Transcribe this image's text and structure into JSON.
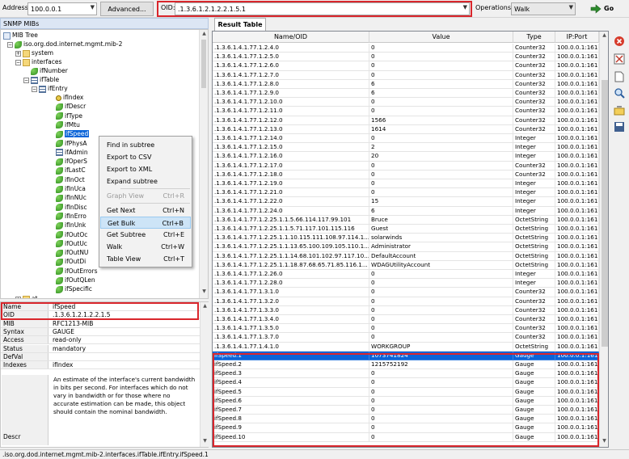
{
  "toolbar": {
    "address_label": "Address:",
    "address_value": "100.0.0.1",
    "advanced_label": "Advanced...",
    "oid_label": "OID:",
    "oid_value": ".1.3.6.1.2.1.2.2.1.5.1",
    "operations_label": "Operations:",
    "operation_value": "Walk",
    "go_label": "Go"
  },
  "left": {
    "panel_title": "SNMP MIBs",
    "tree": [
      {
        "label": "MIB Tree",
        "icon": "tree-icon"
      },
      {
        "label": "iso.org.dod.internet.mgmt.mib-2",
        "icon": "leaf-icon"
      },
      {
        "label": "system",
        "icon": "folder-icon"
      },
      {
        "label": "interfaces",
        "icon": "folder-icon"
      },
      {
        "label": "ifNumber",
        "icon": "leaf-icon"
      },
      {
        "label": "ifTable",
        "icon": "table-icon"
      },
      {
        "label": "ifEntry",
        "icon": "table-icon"
      },
      {
        "label": "ifIndex",
        "icon": "key-icon"
      },
      {
        "label": "ifDescr",
        "icon": "leaf-icon"
      },
      {
        "label": "ifType",
        "icon": "leaf-icon"
      },
      {
        "label": "ifMtu",
        "icon": "leaf-icon"
      },
      {
        "label": "ifSpeed",
        "icon": "leaf-icon"
      },
      {
        "label": "ifPhysA",
        "icon": "leaf-icon"
      },
      {
        "label": "ifAdmin",
        "icon": "edit-icon"
      },
      {
        "label": "ifOperS",
        "icon": "leaf-icon"
      },
      {
        "label": "ifLastC",
        "icon": "leaf-icon"
      },
      {
        "label": "ifInOct",
        "icon": "leaf-icon"
      },
      {
        "label": "ifInUca",
        "icon": "leaf-icon"
      },
      {
        "label": "ifInNUc",
        "icon": "leaf-icon"
      },
      {
        "label": "ifInDisc",
        "icon": "leaf-icon"
      },
      {
        "label": "ifInErro",
        "icon": "leaf-icon"
      },
      {
        "label": "ifInUnk",
        "icon": "leaf-icon"
      },
      {
        "label": "ifOutOc",
        "icon": "leaf-icon"
      },
      {
        "label": "ifOutUc",
        "icon": "leaf-icon"
      },
      {
        "label": "ifOutNU",
        "icon": "leaf-icon"
      },
      {
        "label": "ifOutDi",
        "icon": "leaf-icon"
      },
      {
        "label": "ifOutErrors",
        "icon": "leaf-icon"
      },
      {
        "label": "ifOutQLen",
        "icon": "leaf-icon"
      },
      {
        "label": "ifSpecific",
        "icon": "leaf-icon"
      },
      {
        "label": "at",
        "icon": "folder-icon"
      }
    ],
    "context_menu": [
      {
        "label": "Find in subtree",
        "shortcut": ""
      },
      {
        "label": "Export to CSV",
        "shortcut": ""
      },
      {
        "label": "Export to XML",
        "shortcut": ""
      },
      {
        "label": "Expand subtree",
        "shortcut": ""
      },
      {
        "label": "Graph View",
        "shortcut": "Ctrl+R",
        "disabled": true
      },
      {
        "label": "Get Next",
        "shortcut": "Ctrl+N"
      },
      {
        "label": "Get Bulk",
        "shortcut": "Ctrl+B",
        "highlighted": true
      },
      {
        "label": "Get Subtree",
        "shortcut": "Ctrl+E"
      },
      {
        "label": "Walk",
        "shortcut": "Ctrl+W"
      },
      {
        "label": "Table View",
        "shortcut": "Ctrl+T"
      }
    ],
    "properties": [
      {
        "key": "Name",
        "value": "ifSpeed"
      },
      {
        "key": "OID",
        "value": ".1.3.6.1.2.1.2.2.1.5"
      },
      {
        "key": "MIB",
        "value": "RFC1213-MIB"
      },
      {
        "key": "Syntax",
        "value": "GAUGE"
      },
      {
        "key": "Access",
        "value": "read-only"
      },
      {
        "key": "Status",
        "value": "mandatory"
      },
      {
        "key": "DefVal",
        "value": ""
      },
      {
        "key": "Indexes",
        "value": "ifIndex"
      },
      {
        "key": "Descr",
        "value": ""
      }
    ],
    "descr_text": "An estimate of the interface's current bandwidth in bits per second. For interfaces which do not vary in bandwidth or for those where no accurate estimation can be made, this object should contain the nominal bandwidth."
  },
  "right": {
    "tab_label": "Result Table",
    "columns": [
      "Name/OID",
      "Value",
      "Type",
      "IP:Port"
    ],
    "rows": [
      [
        ".1.3.6.1.4.1.77.1.2.4.0",
        "0",
        "Counter32",
        "100.0.0.1:161"
      ],
      [
        ".1.3.6.1.4.1.77.1.2.5.0",
        "0",
        "Counter32",
        "100.0.0.1:161"
      ],
      [
        ".1.3.6.1.4.1.77.1.2.6.0",
        "0",
        "Counter32",
        "100.0.0.1:161"
      ],
      [
        ".1.3.6.1.4.1.77.1.2.7.0",
        "0",
        "Counter32",
        "100.0.0.1:161"
      ],
      [
        ".1.3.6.1.4.1.77.1.2.8.0",
        "6",
        "Counter32",
        "100.0.0.1:161"
      ],
      [
        ".1.3.6.1.4.1.77.1.2.9.0",
        "6",
        "Counter32",
        "100.0.0.1:161"
      ],
      [
        ".1.3.6.1.4.1.77.1.2.10.0",
        "0",
        "Counter32",
        "100.0.0.1:161"
      ],
      [
        ".1.3.6.1.4.1.77.1.2.11.0",
        "0",
        "Counter32",
        "100.0.0.1:161"
      ],
      [
        ".1.3.6.1.4.1.77.1.2.12.0",
        "1566",
        "Counter32",
        "100.0.0.1:161"
      ],
      [
        ".1.3.6.1.4.1.77.1.2.13.0",
        "1614",
        "Counter32",
        "100.0.0.1:161"
      ],
      [
        ".1.3.6.1.4.1.77.1.2.14.0",
        "0",
        "Integer",
        "100.0.0.1:161"
      ],
      [
        ".1.3.6.1.4.1.77.1.2.15.0",
        "2",
        "Integer",
        "100.0.0.1:161"
      ],
      [
        ".1.3.6.1.4.1.77.1.2.16.0",
        "20",
        "Integer",
        "100.0.0.1:161"
      ],
      [
        ".1.3.6.1.4.1.77.1.2.17.0",
        "0",
        "Counter32",
        "100.0.0.1:161"
      ],
      [
        ".1.3.6.1.4.1.77.1.2.18.0",
        "0",
        "Counter32",
        "100.0.0.1:161"
      ],
      [
        ".1.3.6.1.4.1.77.1.2.19.0",
        "0",
        "Integer",
        "100.0.0.1:161"
      ],
      [
        ".1.3.6.1.4.1.77.1.2.21.0",
        "0",
        "Integer",
        "100.0.0.1:161"
      ],
      [
        ".1.3.6.1.4.1.77.1.2.22.0",
        "15",
        "Integer",
        "100.0.0.1:161"
      ],
      [
        ".1.3.6.1.4.1.77.1.2.24.0",
        "6",
        "Integer",
        "100.0.0.1:161"
      ],
      [
        ".1.3.6.1.4.1.77.1.2.25.1.1.5.66.114.117.99.101",
        "Bruce",
        "OctetString",
        "100.0.0.1:161"
      ],
      [
        ".1.3.6.1.4.1.77.1.2.25.1.1.5.71.117.101.115.116",
        "Guest",
        "OctetString",
        "100.0.0.1:161"
      ],
      [
        ".1.3.6.1.4.1.77.1.2.25.1.1.10.115.111.108.97.114.1...",
        "solarwinds",
        "OctetString",
        "100.0.0.1:161"
      ],
      [
        ".1.3.6.1.4.1.77.1.2.25.1.1.13.65.100.109.105.110.1...",
        "Administrator",
        "OctetString",
        "100.0.0.1:161"
      ],
      [
        ".1.3.6.1.4.1.77.1.2.25.1.1.14.68.101.102.97.117.10...",
        "DefaultAccount",
        "OctetString",
        "100.0.0.1:161"
      ],
      [
        ".1.3.6.1.4.1.77.1.2.25.1.1.18.87.68.65.71.85.116.1...",
        "WDAGUtilityAccount",
        "OctetString",
        "100.0.0.1:161"
      ],
      [
        ".1.3.6.1.4.1.77.1.2.26.0",
        "0",
        "Integer",
        "100.0.0.1:161"
      ],
      [
        ".1.3.6.1.4.1.77.1.2.28.0",
        "0",
        "Integer",
        "100.0.0.1:161"
      ],
      [
        ".1.3.6.1.4.1.77.1.3.1.0",
        "0",
        "Counter32",
        "100.0.0.1:161"
      ],
      [
        ".1.3.6.1.4.1.77.1.3.2.0",
        "0",
        "Counter32",
        "100.0.0.1:161"
      ],
      [
        ".1.3.6.1.4.1.77.1.3.3.0",
        "0",
        "Counter32",
        "100.0.0.1:161"
      ],
      [
        ".1.3.6.1.4.1.77.1.3.4.0",
        "0",
        "Counter32",
        "100.0.0.1:161"
      ],
      [
        ".1.3.6.1.4.1.77.1.3.5.0",
        "0",
        "Counter32",
        "100.0.0.1:161"
      ],
      [
        ".1.3.6.1.4.1.77.1.3.7.0",
        "0",
        "Counter32",
        "100.0.0.1:161"
      ],
      [
        ".1.3.6.1.4.1.77.1.4.1.0",
        "WORKGROUP",
        "OctetString",
        "100.0.0.1:161"
      ],
      [
        "ifSpeed.1",
        "1073741824",
        "Gauge",
        "100.0.0.1:161"
      ],
      [
        "ifSpeed.2",
        "1215752192",
        "Gauge",
        "100.0.0.1:161"
      ],
      [
        "ifSpeed.3",
        "0",
        "Gauge",
        "100.0.0.1:161"
      ],
      [
        "ifSpeed.4",
        "0",
        "Gauge",
        "100.0.0.1:161"
      ],
      [
        "ifSpeed.5",
        "0",
        "Gauge",
        "100.0.0.1:161"
      ],
      [
        "ifSpeed.6",
        "0",
        "Gauge",
        "100.0.0.1:161"
      ],
      [
        "ifSpeed.7",
        "0",
        "Gauge",
        "100.0.0.1:161"
      ],
      [
        "ifSpeed.8",
        "0",
        "Gauge",
        "100.0.0.1:161"
      ],
      [
        "ifSpeed.9",
        "0",
        "Gauge",
        "100.0.0.1:161"
      ],
      [
        "ifSpeed.10",
        "0",
        "Gauge",
        "100.0.0.1:161"
      ]
    ],
    "selected_row": 34
  },
  "status_text": ".iso.org.dod.internet.mgmt.mib-2.interfaces.ifTable.ifEntry.ifSpeed.1",
  "colors": {
    "selection": "#0a64d8",
    "highlight_box": "#d9262c",
    "go_arrow": "#2e8b2e"
  }
}
